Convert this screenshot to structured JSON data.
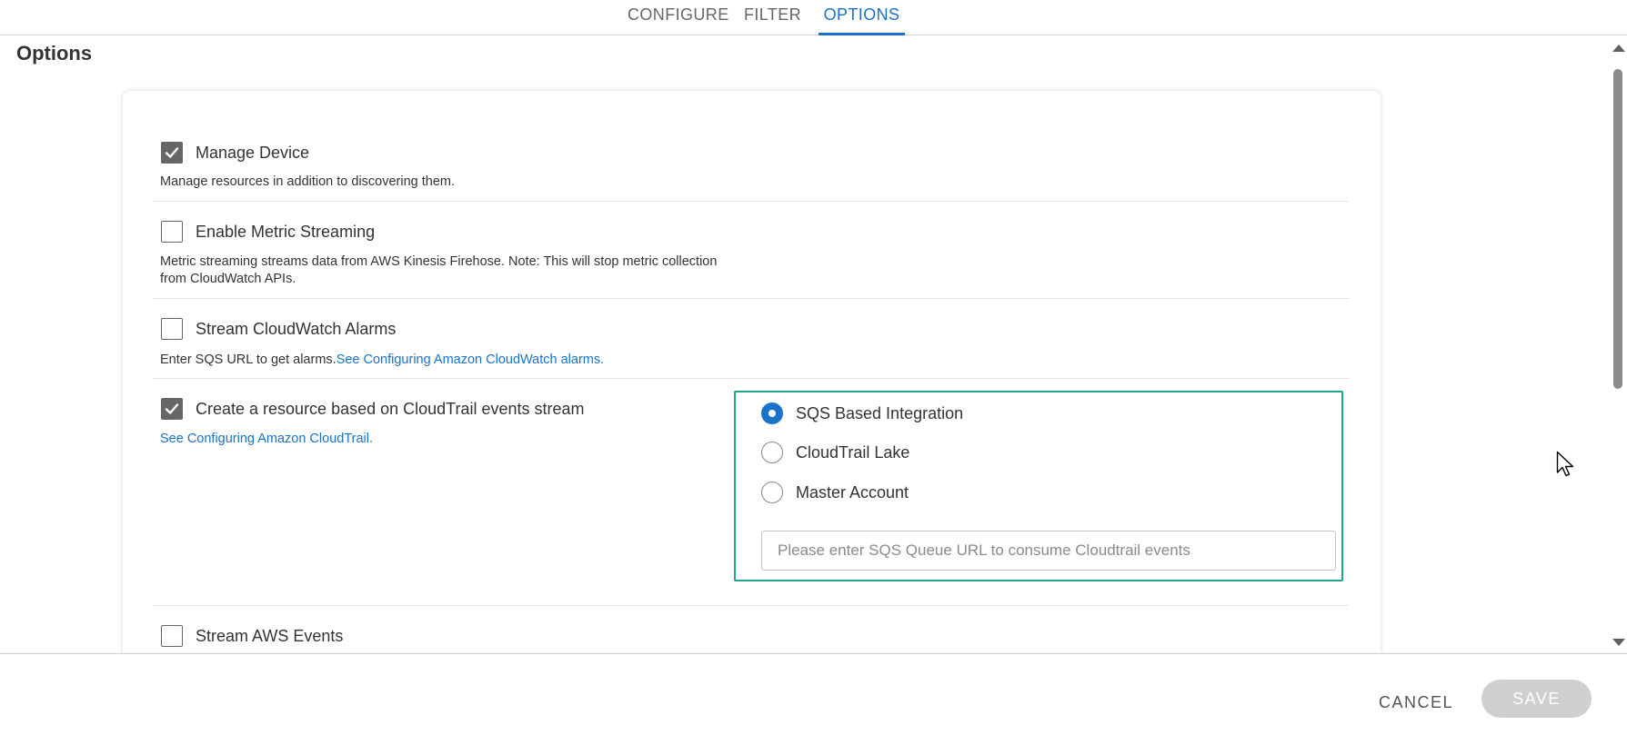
{
  "tabs": [
    {
      "label": "CONFIGURE",
      "active": false
    },
    {
      "label": "FILTER",
      "active": false
    },
    {
      "label": "OPTIONS",
      "active": true
    }
  ],
  "page": {
    "title": "Options"
  },
  "options": {
    "manage_device": {
      "label": "Manage Device",
      "checked": true,
      "description": "Manage resources in addition to discovering them."
    },
    "metric_streaming": {
      "label": "Enable Metric Streaming",
      "checked": false,
      "description_line1": "Metric streaming streams data from AWS Kinesis Firehose. Note: This will stop metric collection",
      "description_line2": "from CloudWatch APIs."
    },
    "cloudwatch_alarms": {
      "label": "Stream CloudWatch Alarms",
      "checked": false,
      "description": "Enter SQS URL to get alarms.",
      "link": "See Configuring Amazon CloudWatch alarms."
    },
    "cloudtrail": {
      "label": "Create a resource based on CloudTrail events stream",
      "checked": true,
      "link": "See Configuring Amazon CloudTrail.",
      "radios": [
        {
          "label": "SQS Based Integration",
          "selected": true
        },
        {
          "label": "CloudTrail Lake",
          "selected": false
        },
        {
          "label": "Master Account",
          "selected": false
        }
      ],
      "sqs_input": {
        "value": "",
        "placeholder": "Please enter SQS Queue URL to consume Cloudtrail events"
      }
    },
    "aws_events": {
      "label": "Stream AWS Events",
      "checked": false
    }
  },
  "footer": {
    "cancel_label": "CANCEL",
    "save_label": "SAVE"
  },
  "colors": {
    "accent": "#1a73c8",
    "highlight_border": "#20a88c",
    "checkbox_checked": "#666666",
    "save_disabled": "#cfcfcf"
  }
}
